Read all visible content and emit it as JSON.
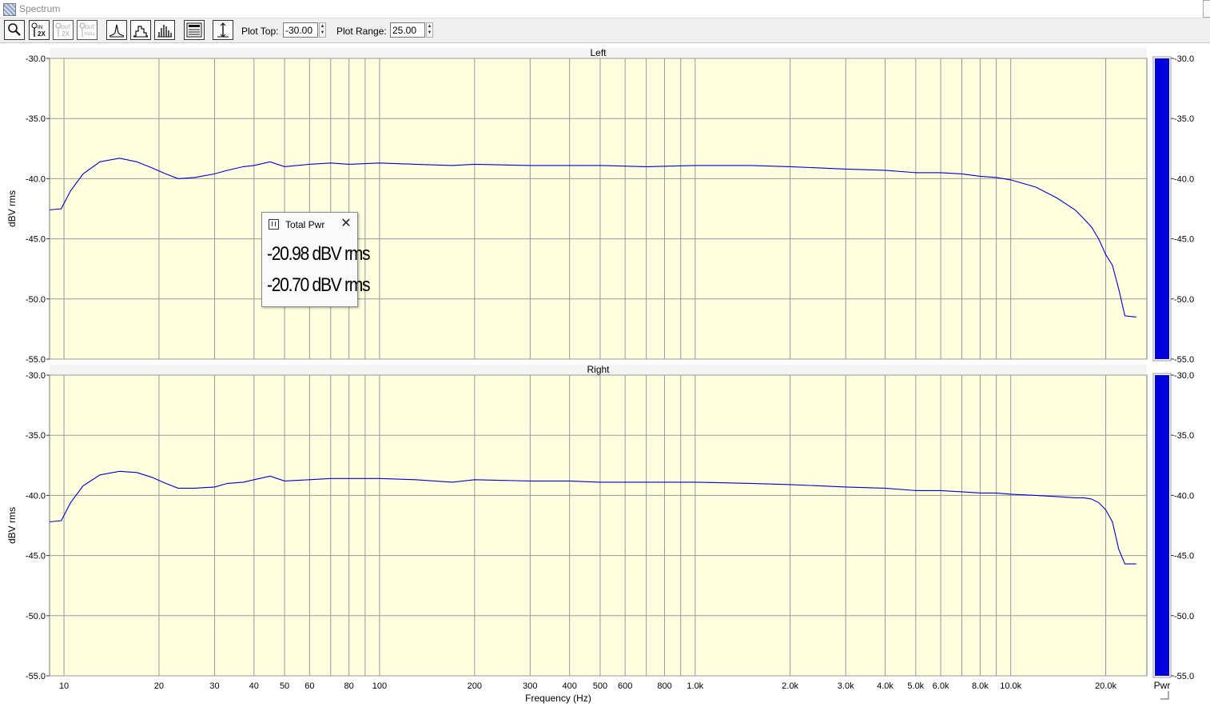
{
  "window": {
    "title": "Spectrum"
  },
  "toolbar": {
    "buttons": [
      {
        "name": "zoom-button",
        "icon": "magnifier-icon"
      },
      {
        "name": "zoom-in-2x-button",
        "icon": "zoom-in-2x-icon",
        "text": "IN 2X"
      },
      {
        "name": "zoom-out-2x-button",
        "icon": "zoom-out-2x-icon",
        "text": "OUT 2X",
        "disabled": true
      },
      {
        "name": "zoom-out-full-button",
        "icon": "zoom-out-full-icon",
        "text": "OUT FULL",
        "disabled": true
      },
      {
        "name": "line-plot-button",
        "icon": "line-plot-icon"
      },
      {
        "name": "step-plot-button",
        "icon": "step-plot-icon"
      },
      {
        "name": "bar-plot-button",
        "icon": "bar-plot-icon"
      },
      {
        "name": "display-options-button",
        "icon": "list-window-icon"
      },
      {
        "name": "cursor-button",
        "icon": "vertical-cursor-icon"
      }
    ],
    "plot_top_label": "Plot Top:",
    "plot_top_value": "-30.00",
    "plot_range_label": "Plot Range:",
    "plot_range_value": "25.00"
  },
  "popup": {
    "title": "Total Pwr",
    "values": [
      "-20.98 dBV rms",
      "-20.70 dBV rms"
    ]
  },
  "colors": {
    "plot_bg": "#ffffe0",
    "trace": "#0000cc",
    "meter": "#0000dd",
    "grid": "#999999"
  },
  "chart_data": [
    {
      "type": "line",
      "title": "Left",
      "xlabel": "",
      "ylabel": "dBV rms",
      "x_scale": "log",
      "xlim": [
        9,
        27000
      ],
      "ylim": [
        -55.0,
        -30.0
      ],
      "y_ticks": [
        "-30.0",
        "-35.0",
        "-40.0",
        "-45.0",
        "-50.0",
        "-55.0"
      ],
      "grid": true,
      "meter_label": "",
      "meter_ticks": [
        "-30.0",
        "-35.0",
        "-40.0",
        "-45.0",
        "-50.0",
        "-55.0"
      ],
      "meter_level": -30.0,
      "x": [
        9,
        9.8,
        10.5,
        11.5,
        13,
        15,
        17,
        19,
        21,
        23,
        26,
        30,
        33,
        37,
        40,
        45,
        50,
        60,
        70,
        80,
        100,
        130,
        170,
        200,
        300,
        400,
        500,
        700,
        1000,
        1500,
        2000,
        3000,
        4000,
        5000,
        6000,
        7000,
        8000,
        9000,
        10000,
        12000,
        14000,
        16000,
        17000,
        18000,
        19000,
        20000,
        21000,
        22000,
        23000,
        25000
      ],
      "y": [
        -42.6,
        -42.5,
        -41.0,
        -39.6,
        -38.6,
        -38.3,
        -38.6,
        -39.1,
        -39.6,
        -40.0,
        -39.9,
        -39.6,
        -39.3,
        -39.0,
        -38.9,
        -38.6,
        -39.0,
        -38.8,
        -38.7,
        -38.8,
        -38.7,
        -38.8,
        -38.9,
        -38.8,
        -38.9,
        -38.9,
        -38.9,
        -39.0,
        -38.9,
        -38.9,
        -39.0,
        -39.2,
        -39.3,
        -39.5,
        -39.5,
        -39.6,
        -39.8,
        -39.9,
        -40.1,
        -40.7,
        -41.6,
        -42.6,
        -43.3,
        -44.0,
        -45.0,
        -46.3,
        -47.2,
        -49.2,
        -51.4,
        -51.5
      ]
    },
    {
      "type": "line",
      "title": "Right",
      "xlabel": "Frequency (Hz)",
      "ylabel": "dBV rms",
      "x_scale": "log",
      "xlim": [
        9,
        27000
      ],
      "x_ticks": [
        "10",
        "20",
        "30",
        "40",
        "50",
        "60",
        "80",
        "100",
        "200",
        "300",
        "400",
        "500",
        "600",
        "800",
        "1.0k",
        "2.0k",
        "3.0k",
        "4.0k",
        "5.0k",
        "6.0k",
        "8.0k",
        "10.0k",
        "20.0k"
      ],
      "x_tick_values": [
        10,
        20,
        30,
        40,
        50,
        60,
        80,
        100,
        200,
        300,
        400,
        500,
        600,
        800,
        1000,
        2000,
        3000,
        4000,
        5000,
        6000,
        8000,
        10000,
        20000
      ],
      "ylim": [
        -55.0,
        -30.0
      ],
      "y_ticks": [
        "-30.0",
        "-35.0",
        "-40.0",
        "-45.0",
        "-50.0",
        "-55.0"
      ],
      "grid": true,
      "meter_label": "Pwr",
      "meter_ticks": [
        "-30.0",
        "-35.0",
        "-40.0",
        "-45.0",
        "-50.0",
        "-55.0"
      ],
      "meter_level": -30.0,
      "x": [
        9,
        9.8,
        10.5,
        11.5,
        13,
        15,
        17,
        19,
        21,
        23,
        26,
        30,
        33,
        37,
        40,
        45,
        50,
        60,
        70,
        80,
        100,
        130,
        170,
        200,
        300,
        400,
        500,
        700,
        1000,
        1500,
        2000,
        3000,
        4000,
        5000,
        6000,
        7000,
        8000,
        9000,
        10000,
        12000,
        14000,
        16000,
        17000,
        18000,
        19000,
        20000,
        21000,
        22000,
        23000,
        25000
      ],
      "y": [
        -42.2,
        -42.1,
        -40.6,
        -39.2,
        -38.3,
        -38.0,
        -38.1,
        -38.5,
        -39.0,
        -39.4,
        -39.4,
        -39.3,
        -39.0,
        -38.9,
        -38.7,
        -38.4,
        -38.8,
        -38.7,
        -38.6,
        -38.6,
        -38.6,
        -38.7,
        -38.9,
        -38.7,
        -38.8,
        -38.8,
        -38.9,
        -38.9,
        -38.9,
        -39.0,
        -39.1,
        -39.3,
        -39.4,
        -39.6,
        -39.6,
        -39.7,
        -39.8,
        -39.8,
        -39.9,
        -40.0,
        -40.1,
        -40.2,
        -40.2,
        -40.3,
        -40.6,
        -41.2,
        -42.2,
        -44.5,
        -45.7,
        -45.7
      ]
    }
  ]
}
